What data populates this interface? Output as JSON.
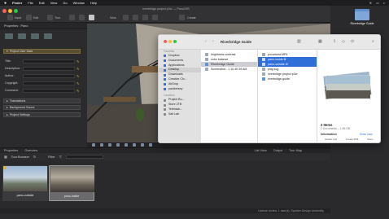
{
  "menubar": {
    "apple": "",
    "items": [
      "Finder",
      "File",
      "Edit",
      "View",
      "Go",
      "Window",
      "Help"
    ]
  },
  "app": {
    "title": "riverbridge project.p3vr — Pano2VR",
    "toolbar": {
      "left_labels": [
        "Input",
        "Edit",
        "Tour"
      ],
      "view_label": "View",
      "create_label": "Create"
    },
    "properties": {
      "header": "Properties : Pano",
      "project_user_data": "Project User Data",
      "fields": [
        {
          "label": "Title:"
        },
        {
          "label": "Description:"
        },
        {
          "label": "Author:"
        },
        {
          "label": "Copyright:"
        },
        {
          "label": "Comment:"
        }
      ],
      "sections": [
        "Translations",
        "Background Sound",
        "Project Settings"
      ]
    },
    "output_header": "Output",
    "bottom_tabs": [
      "Properties",
      "Overview"
    ],
    "viewport_tabs": [
      "Tour Browser"
    ],
    "right_tabs": [
      "List View",
      "Output",
      "Tour Map"
    ],
    "filter_label": "Filter",
    "tours": [
      {
        "name": "pano-outside"
      },
      {
        "name": "pano-inside"
      }
    ],
    "status": "License review, 1 user(s), Spartan Design University"
  },
  "finder": {
    "title": "Riverbridge Guide",
    "sidebar": {
      "favorites_title": "Favorites",
      "favorites": [
        "Dropbox",
        "Documents",
        "Applications",
        "Desktop",
        "Downloads",
        "Creative Clo...",
        "AirDrop",
        "paulkersey"
      ],
      "locations_title": "Locations",
      "locations": [
        "Project Bu...",
        "Store 2TB",
        "Teleback...",
        "Sail Lab"
      ]
    },
    "col1": [
      {
        "name": "brightness contrast"
      },
      {
        "name": "color balance"
      },
      {
        "name": "Riverbridge Guide",
        "selected": true
      },
      {
        "name": "Screenshot...1 10.49.39 AM"
      }
    ],
    "col2": [
      {
        "name": "pncamera.MP4"
      },
      {
        "name": "pano-inside.tif",
        "selected": true
      },
      {
        "name": "pano-outside.tif",
        "selected": true
      },
      {
        "name": "plag.svg"
      },
      {
        "name": "riverbridge project.p3vr"
      },
      {
        "name": "riverbridge-guide"
      }
    ],
    "preview": {
      "items_count": "2 Items",
      "items_sub": "2 Documents – 1.56 GB",
      "info_label": "Information",
      "show_less": "Show Less",
      "actions": [
        "Rotate Left",
        "Create PDF",
        "More..."
      ]
    }
  },
  "desktop_icon": {
    "label": "Riverbridge Guide"
  }
}
